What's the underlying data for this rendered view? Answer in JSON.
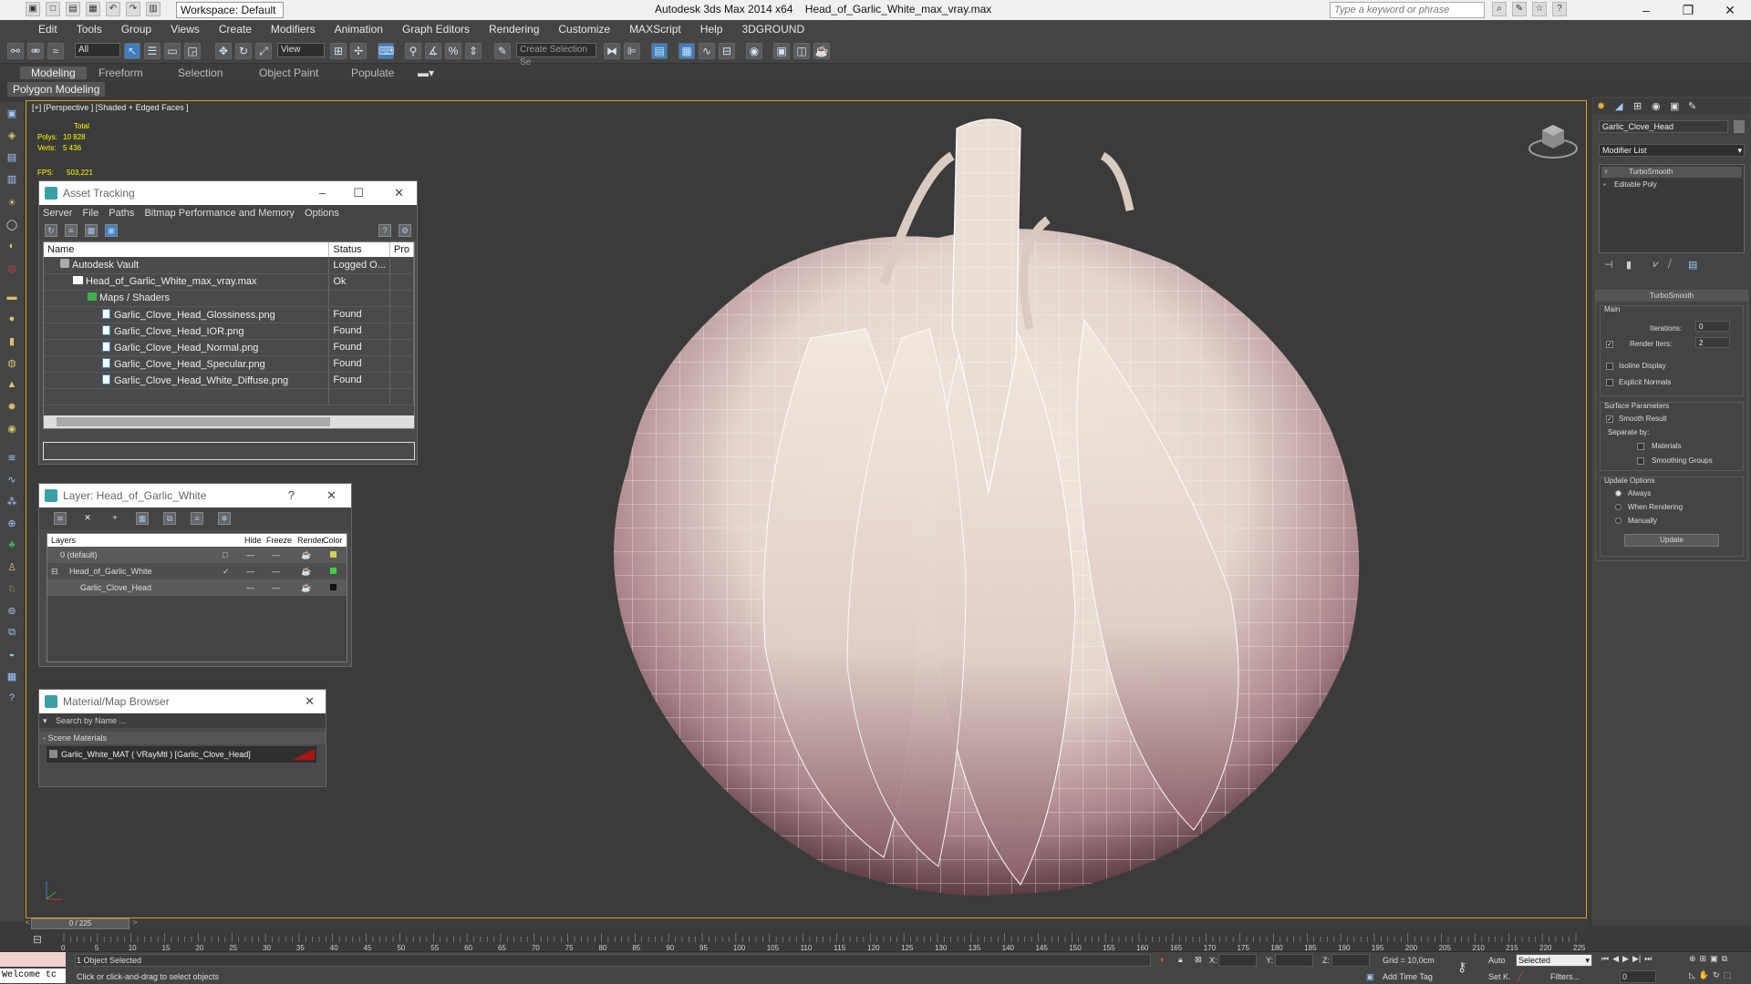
{
  "titlebar": {
    "workspace": "Workspace: Default",
    "app_title": "Autodesk 3ds Max  2014 x64",
    "file_title": "Head_of_Garlic_White_max_vray.max",
    "search_placeholder": "Type a keyword or phrase"
  },
  "menu": [
    "Edit",
    "Tools",
    "Group",
    "Views",
    "Create",
    "Modifiers",
    "Animation",
    "Graph Editors",
    "Rendering",
    "Customize",
    "MAXScript",
    "Help",
    "3DGROUND"
  ],
  "toolbar": {
    "filter_select": "All",
    "refcoord_select": "View",
    "selection_set": "Create Selection Se"
  },
  "ribbon": {
    "tabs": [
      "Modeling",
      "Freeform",
      "Selection",
      "Object Paint",
      "Populate"
    ],
    "active_tab": "Modeling",
    "sub": "Polygon Modeling"
  },
  "viewport": {
    "label": "[+] [Perspective ] [Shaded + Edged Faces ]",
    "stats_header": "Total",
    "polys_label": "Polys:",
    "polys_value": "10 828",
    "verts_label": "Verts:",
    "verts_value": "5 436",
    "fps_label": "FPS:",
    "fps_value": "503,221"
  },
  "asset_tracking": {
    "title": "Asset Tracking",
    "menu": [
      "Server",
      "File",
      "Paths",
      "Bitmap Performance and Memory",
      "Options"
    ],
    "columns": [
      "Name",
      "Status",
      "Pro"
    ],
    "rows": [
      {
        "name": "Autodesk Vault",
        "status": "Logged O...",
        "type": "vault"
      },
      {
        "name": "Head_of_Garlic_White_max_vray.max",
        "status": "Ok",
        "type": "max"
      },
      {
        "name": "Maps / Shaders",
        "status": "",
        "type": "folder"
      },
      {
        "name": "Garlic_Clove_Head_Glossiness.png",
        "status": "Found",
        "type": "file"
      },
      {
        "name": "Garlic_Clove_Head_IOR.png",
        "status": "Found",
        "type": "file"
      },
      {
        "name": "Garlic_Clove_Head_Normal.png",
        "status": "Found",
        "type": "file"
      },
      {
        "name": "Garlic_Clove_Head_Specular.png",
        "status": "Found",
        "type": "file"
      },
      {
        "name": "Garlic_Clove_Head_White_Diffuse.png",
        "status": "Found",
        "type": "file"
      }
    ]
  },
  "layer_panel": {
    "title": "Layer: Head_of_Garlic_White",
    "help": "?",
    "columns": [
      "Layers",
      "Hide",
      "Freeze",
      "Render",
      "Color"
    ],
    "rows": [
      {
        "name": "0 (default)",
        "color": "#d4d44a"
      },
      {
        "name": "Head_of_Garlic_White",
        "color": "#3fd13f"
      },
      {
        "name": "Garlic_Clove_Head",
        "color": "#111111"
      }
    ]
  },
  "material_browser": {
    "title": "Material/Map Browser",
    "search_placeholder": "Search by Name ...",
    "section": "- Scene Materials",
    "material": "Garlic_White_MAT  ( VRayMtl ) [Garlic_Clove_Head]"
  },
  "command_panel": {
    "object_name": "Garlic_Clove_Head",
    "modifier_list": "Modifier List",
    "stack": [
      "TurboSmooth",
      "Editable Poly"
    ],
    "rollout_title": "TurboSmooth",
    "main_label": "Main",
    "iterations_label": "Iterations:",
    "iterations_value": "0",
    "render_iters_label": "Render Iters:",
    "render_iters_value": "2",
    "isoline": "Isoline Display",
    "explicit_normals": "Explicit Normals",
    "surface_params": "Surface Parameters",
    "smooth_result": "Smooth Result",
    "separate_by": "Separate by:",
    "materials": "Materials",
    "smoothing_groups": "Smoothing Groups",
    "update_options": "Update Options",
    "always": "Always",
    "when_rendering": "When Rendering",
    "manually": "Manually",
    "update_button": "Update"
  },
  "timeline": {
    "frame": "0 / 225",
    "ticks": [
      "0",
      "5",
      "10",
      "15",
      "20",
      "25",
      "30",
      "35",
      "40",
      "45",
      "50",
      "55",
      "60",
      "65",
      "70",
      "75",
      "80",
      "85",
      "90",
      "95",
      "100",
      "105",
      "110",
      "115",
      "120",
      "125",
      "130",
      "135",
      "140",
      "145",
      "150",
      "155",
      "160",
      "165",
      "170",
      "175",
      "180",
      "185",
      "190",
      "195",
      "200",
      "205",
      "210",
      "215",
      "220",
      "225"
    ]
  },
  "status": {
    "listener": "Welcome tc",
    "selected": "1 Object Selected",
    "prompt": "Click or click-and-drag to select objects",
    "x_label": "X:",
    "y_label": "Y:",
    "z_label": "Z:",
    "grid": "Grid = 10,0cm",
    "add_time_tag": "Add Time Tag",
    "auto": "Auto",
    "set_key": "Set K.",
    "selected_dropdown": "Selected",
    "filters": "Filters...",
    "frame_field": "0"
  }
}
